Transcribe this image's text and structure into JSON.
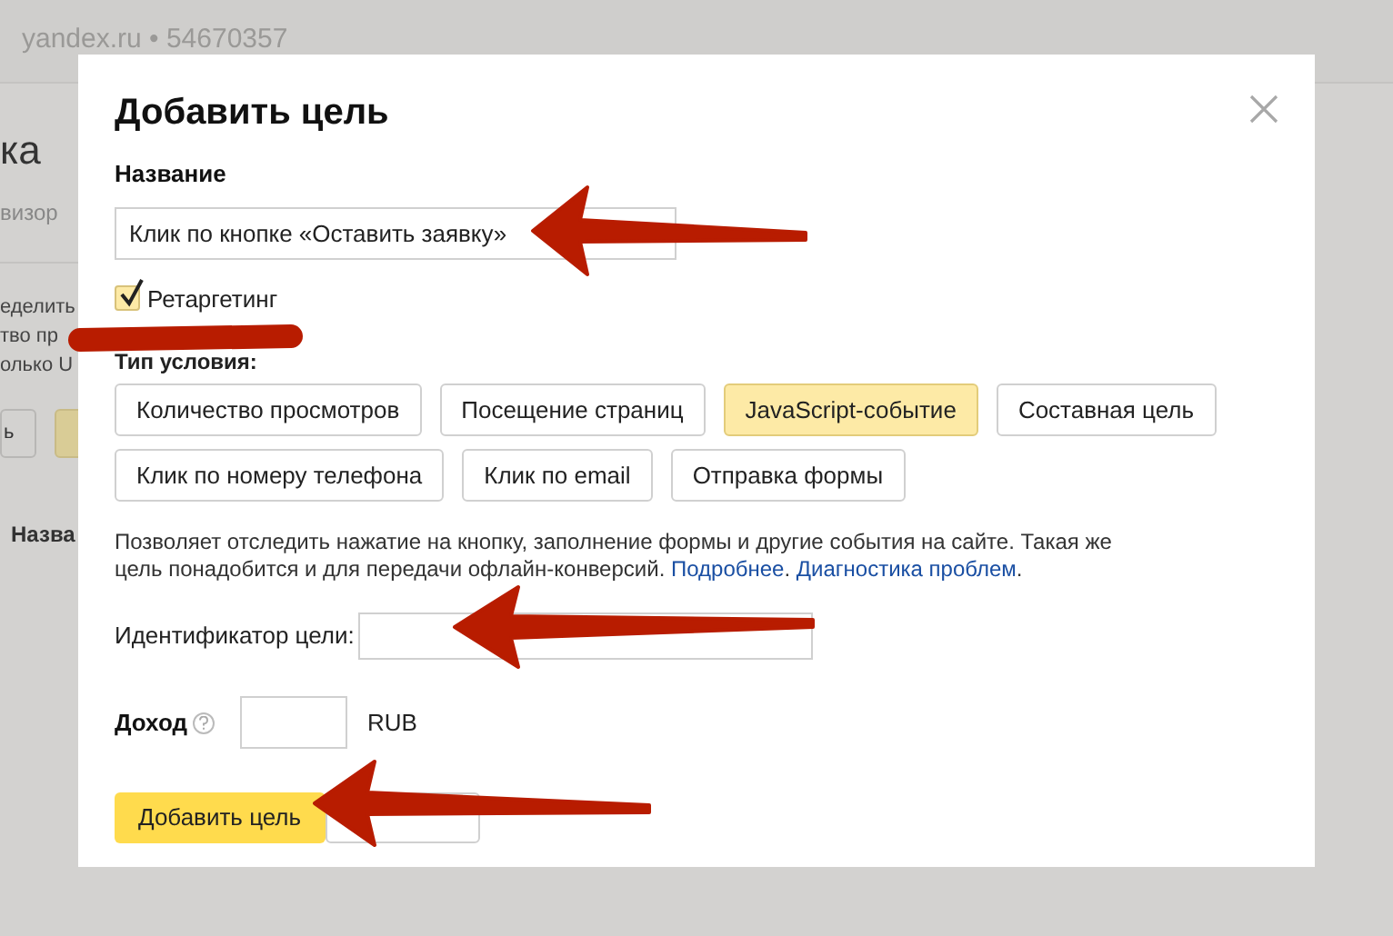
{
  "background_page": {
    "header": "yandex.ru • 54670357",
    "title_fragment": "ка",
    "subtitle_fragment": "визор",
    "text_fragments": [
      "еделить",
      "тво пр",
      "олько U"
    ],
    "button_fragment": "ь",
    "column_fragment": "Назва"
  },
  "dialog": {
    "title": "Добавить цель",
    "name_label": "Название",
    "name_value": "Клик по кнопке «Оставить заявку»",
    "retargeting": {
      "label": "Ретаргетинг",
      "checked": true
    },
    "condition_label": "Тип условия:",
    "condition_types": [
      {
        "label": "Количество просмотров",
        "selected": false
      },
      {
        "label": "Посещение страниц",
        "selected": false
      },
      {
        "label": "JavaScript-событие",
        "selected": true
      },
      {
        "label": "Составная цель",
        "selected": false
      },
      {
        "label": "Клик по номеру телефона",
        "selected": false
      },
      {
        "label": "Клик по email",
        "selected": false
      },
      {
        "label": "Отправка формы",
        "selected": false
      }
    ],
    "description": [
      {
        "kind": "text",
        "text": "Позволяет отследить нажатие на кнопку, заполнение формы и другие события на сайте. Такая же цель понадобится и для передачи офлайн-конверсий. "
      },
      {
        "kind": "link",
        "text": "Подробнее"
      },
      {
        "kind": "text",
        "text": ". "
      },
      {
        "kind": "link",
        "text": "Диагностика проблем"
      },
      {
        "kind": "text",
        "text": "."
      }
    ],
    "id_label": "Идентификатор цели:",
    "income_label": "Доход",
    "currency": "RUB",
    "submit": "Добавить цель"
  }
}
